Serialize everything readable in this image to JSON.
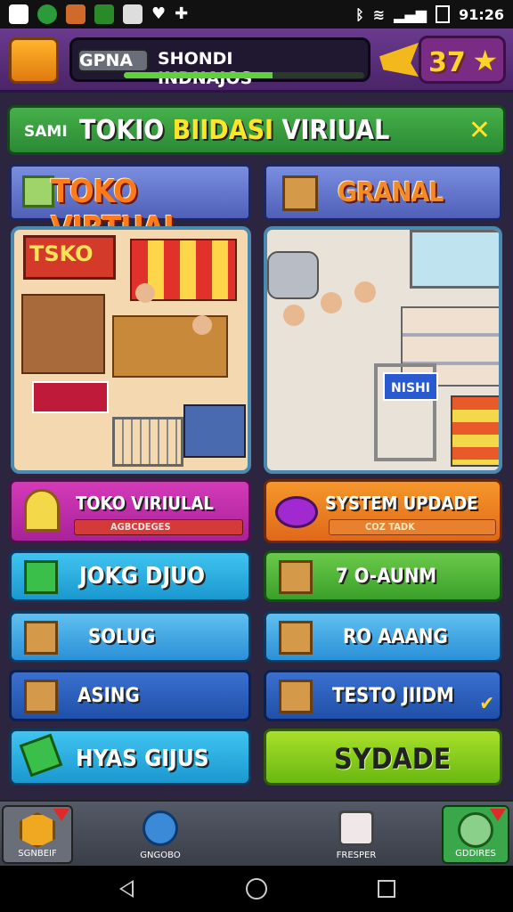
{
  "status": {
    "time": "91:26"
  },
  "header": {
    "name_prefix": "GPNA",
    "name": "SHONDI INDNAJOS",
    "xp_level": 0.62,
    "score": "37"
  },
  "banner": {
    "prefix": "SAMI",
    "title_a": "TOKIO ",
    "title_b": "BIIDASI",
    "title_c": " VIRIUAL"
  },
  "categories": {
    "left": "TOKO VIRTUAL",
    "right": "GRANAL"
  },
  "scenes": {
    "left_sign": "TSKO",
    "right_sign": "NISHI"
  },
  "buttons": {
    "pink": {
      "label": "TOKO VIRIULAL",
      "sub": "AGBCDEGES"
    },
    "orange": {
      "label": "SYSTEM UPDADE",
      "sub": "COZ TADK"
    },
    "b1": "JOKG DJUO",
    "b2": "7   O-AUNM",
    "b3": "SOLUG",
    "b4": "RO AAANG",
    "b5": "ASING",
    "b6": "TESTO JIIDM",
    "b7": "HYAS GIJUS",
    "b8": "SYDADE"
  },
  "nav": {
    "n1": "SGNBEIF",
    "n2": "GNGOBO",
    "n3": "FRESPER",
    "n4": "GDDIRES"
  },
  "colors": {
    "accent": "#6bc94a",
    "brand": "#6a3a8f",
    "score": "#ffd42a"
  }
}
